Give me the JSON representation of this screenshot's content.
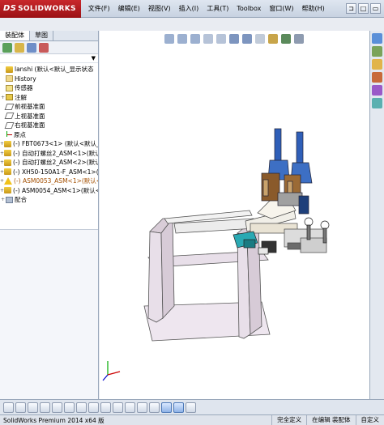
{
  "app": {
    "logo": "SOLIDWORKS",
    "logo_prefix": "DS",
    "menu": [
      "文件(F)",
      "编辑(E)",
      "视图(V)",
      "插入(I)",
      "工具(T)",
      "Toolbox",
      "窗口(W)",
      "帮助(H)"
    ]
  },
  "leftpanel": {
    "tabs": [
      "装配体",
      "草图"
    ],
    "tree": [
      {
        "label": "lanshi  (默认<默认_显示状态",
        "icon": "asm",
        "expander": ""
      },
      {
        "label": "History",
        "icon": "folder",
        "expander": ""
      },
      {
        "label": "传感器",
        "icon": "sensor",
        "expander": ""
      },
      {
        "label": "注解",
        "icon": "anno",
        "expander": "+"
      },
      {
        "label": "前视基准面",
        "icon": "plane",
        "expander": ""
      },
      {
        "label": "上视基准面",
        "icon": "plane",
        "expander": ""
      },
      {
        "label": "右视基准面",
        "icon": "plane",
        "expander": ""
      },
      {
        "label": "原点",
        "icon": "origin",
        "expander": ""
      },
      {
        "label": "(-) FBT0673<1> (默认<默认_",
        "icon": "asm",
        "expander": "+"
      },
      {
        "label": "(-) 自动打螺丝2_ASM<1>(默认",
        "icon": "asm",
        "expander": "+"
      },
      {
        "label": "(-) 自动打螺丝2_ASM<2>(默认",
        "icon": "asm",
        "expander": "+"
      },
      {
        "label": "(-) XH50-150A1-F_ASM<1>(默",
        "icon": "asm",
        "expander": "+"
      },
      {
        "label": "(-) ASM0053_ASM<1>(默认<默",
        "icon": "warn",
        "expander": "+"
      },
      {
        "label": "(-) ASM0054_ASM<1>(默认<默",
        "icon": "asm",
        "expander": "+"
      },
      {
        "label": "配合",
        "icon": "mate",
        "expander": "+"
      }
    ]
  },
  "status": {
    "product": "SolidWorks Premium 2014 x64 版",
    "defined": "完全定义",
    "mode": "在编辑 装配体",
    "custom": "自定义"
  },
  "colors": {
    "brand": "#b81c20",
    "frame_fill": "#e8dfe9",
    "gun_blue": "#2f5fb8",
    "block_brown": "#8a5a2b",
    "cyan_part": "#2aa9b3"
  }
}
